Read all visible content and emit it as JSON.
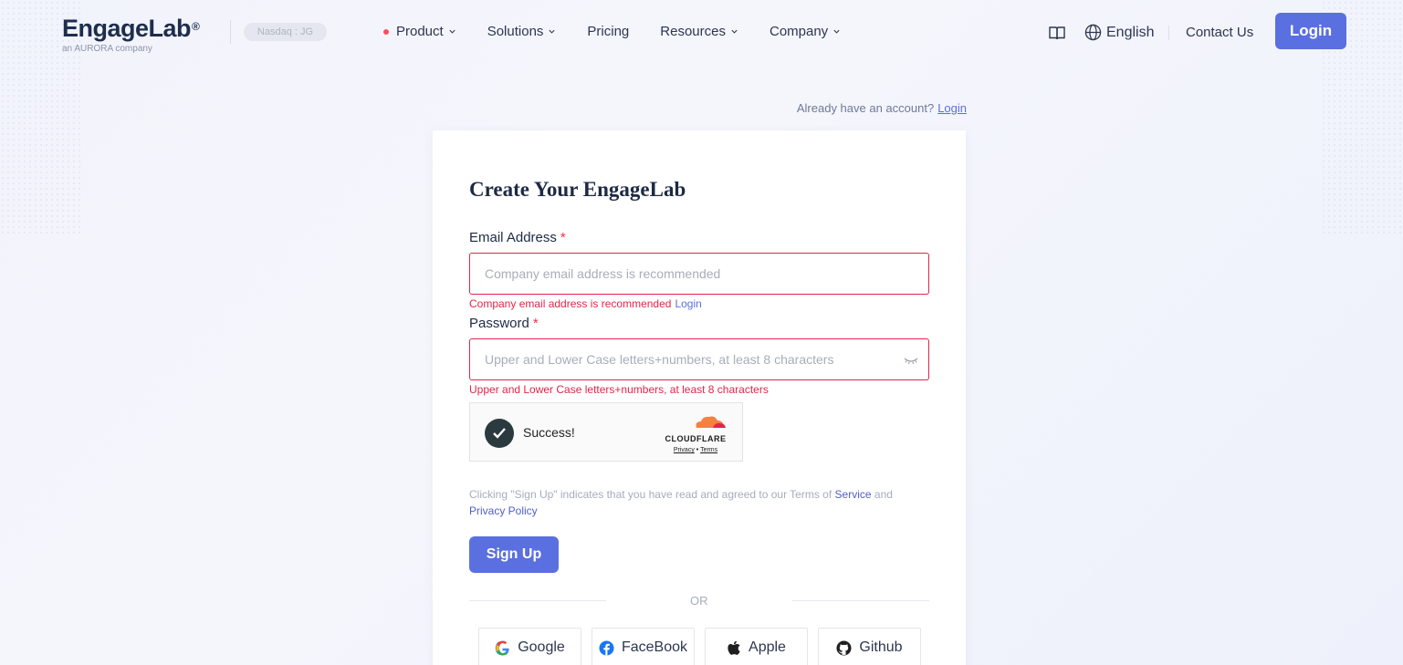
{
  "header": {
    "logo_text": "EngageLab",
    "logo_mark": "®",
    "logo_sub": "an AURORA company",
    "nasdaq": "Nasdaq : JG",
    "nav": [
      {
        "label": "Product",
        "has_dot": true,
        "has_menu": true
      },
      {
        "label": "Solutions",
        "has_menu": true
      },
      {
        "label": "Pricing",
        "has_menu": false
      },
      {
        "label": "Resources",
        "has_menu": true
      },
      {
        "label": "Company",
        "has_menu": true
      }
    ],
    "language": "English",
    "contact": "Contact Us",
    "login": "Login"
  },
  "account": {
    "prompt": "Already have an account?",
    "login_link": "Login"
  },
  "form": {
    "title": "Create Your EngageLab",
    "required_mark": "*",
    "email": {
      "label": "Email Address",
      "placeholder": "Company email address is recommended",
      "value": "",
      "error": "Company email address is recommended",
      "error_link": "Login"
    },
    "password": {
      "label": "Password",
      "placeholder": "Upper and Lower Case letters+numbers, at least 8 characters",
      "value": "",
      "error": "Upper and Lower Case letters+numbers, at least 8 characters"
    },
    "captcha": {
      "status": "Success!",
      "brand": "CLOUDFLARE",
      "privacy": "Privacy",
      "separator": "•",
      "terms": "Terms"
    },
    "terms": {
      "prefix": "Clicking \"Sign Up\" indicates that you have read and agreed to our Terms of",
      "service": "Service",
      "and": "and",
      "privacy": "Privacy Policy"
    },
    "signup": "Sign Up",
    "or": "OR",
    "socials": [
      {
        "label": "Google",
        "icon": "google-icon"
      },
      {
        "label": "FaceBook",
        "icon": "facebook-icon"
      },
      {
        "label": "Apple",
        "icon": "apple-icon"
      },
      {
        "label": "Github",
        "icon": "github-icon"
      }
    ]
  },
  "colors": {
    "accent": "#5a6fe0",
    "error": "#e0264b",
    "dot": "#ff4d5c"
  }
}
